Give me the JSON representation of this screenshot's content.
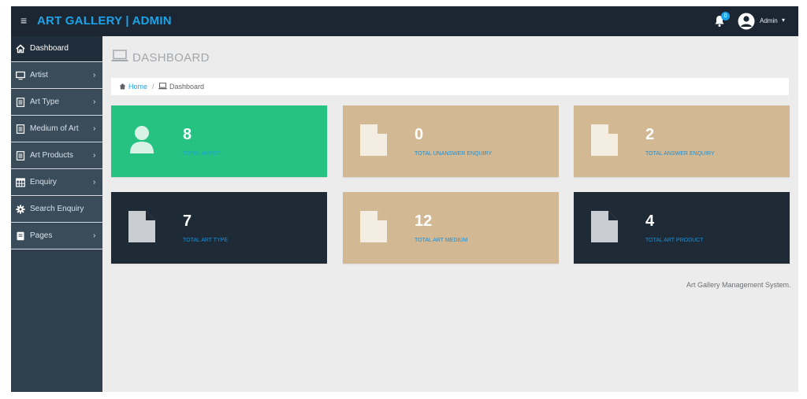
{
  "header": {
    "menu_icon": "hamburger-icon",
    "brand": "ART GALLERY | ADMIN",
    "notifications": {
      "icon": "bell-icon",
      "count": "0"
    },
    "user": {
      "icon": "user-circle-icon",
      "name": "Admin",
      "caret": "▾"
    }
  },
  "sidebar": {
    "items": [
      {
        "label": "Dashboard",
        "icon": "home-icon",
        "active": true,
        "chevron": ""
      },
      {
        "label": "Artist",
        "icon": "monitor-icon",
        "chevron": "›"
      },
      {
        "label": "Art Type",
        "icon": "document-icon",
        "chevron": "›"
      },
      {
        "label": "Medium of Art",
        "icon": "document-icon",
        "chevron": "›"
      },
      {
        "label": "Art Products",
        "icon": "document-icon",
        "chevron": "›"
      },
      {
        "label": "Enquiry",
        "icon": "table-icon",
        "chevron": "›"
      },
      {
        "label": "Search Enquiry",
        "icon": "gear-icon",
        "chevron": ""
      },
      {
        "label": "Pages",
        "icon": "file-icon",
        "chevron": "›"
      }
    ]
  },
  "page": {
    "title": "DASHBOARD",
    "title_icon": "laptop-icon",
    "breadcrumb": {
      "home": "Home",
      "separator": "/",
      "current": "Dashboard"
    }
  },
  "cards": [
    {
      "value": "8",
      "label": "TOTAL ARTIST",
      "icon": "user-icon",
      "style": "green"
    },
    {
      "value": "0",
      "label": "TOTAL UNANSWER ENQUIRY",
      "icon": "file-icon",
      "style": "tan"
    },
    {
      "value": "2",
      "label": "TOTAL ANSWER ENQUIRY",
      "icon": "file-icon",
      "style": "tan"
    },
    {
      "value": "7",
      "label": "TOTAL ART TYPE",
      "icon": "file-icon",
      "style": "dark"
    },
    {
      "value": "12",
      "label": "TOTAL ART MEDIUM",
      "icon": "file-icon",
      "style": "tan"
    },
    {
      "value": "4",
      "label": "TOTAL ART PRODUCT",
      "icon": "file-icon",
      "style": "dark"
    }
  ],
  "footer": {
    "text": "Art Gallery Management System."
  },
  "colors": {
    "accent": "#1aa3e8",
    "green": "#26c281",
    "tan": "#d2b993",
    "dark": "#1f2a37",
    "sidebar": "#3a4b59"
  }
}
